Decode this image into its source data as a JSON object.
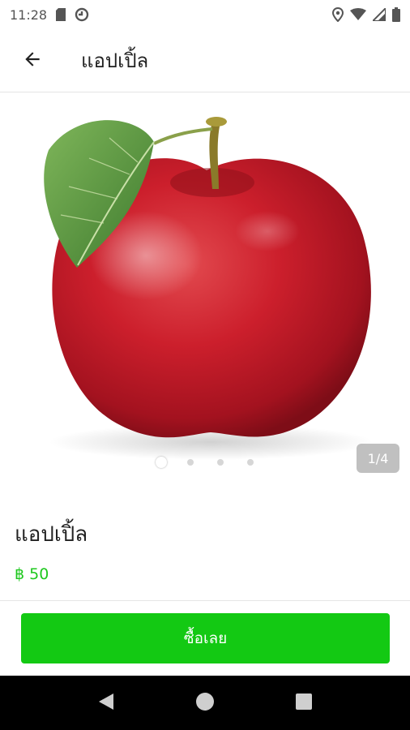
{
  "status_bar": {
    "time": "11:28",
    "icons_left": [
      "sd-card-icon",
      "sync-icon"
    ],
    "icons_right": [
      "location-icon",
      "wifi-icon",
      "signal-icon",
      "battery-icon"
    ]
  },
  "app_bar": {
    "back_icon": "arrow-back-icon",
    "title": "แอปเปิ้ล"
  },
  "gallery": {
    "image_subject": "red apple with leaf",
    "counter": "1/4",
    "total_pages": 4,
    "active_index": 0
  },
  "product": {
    "name": "แอปเปิ้ล",
    "price": "฿ 50"
  },
  "buy_button": {
    "label": "ซื้อเลย"
  },
  "nav_bar": {
    "icons": [
      "nav-back-icon",
      "nav-home-icon",
      "nav-recents-icon"
    ]
  },
  "colors": {
    "accent_green": "#13c913",
    "price_green": "#1ec81e",
    "apple_red": "#c8202c"
  }
}
